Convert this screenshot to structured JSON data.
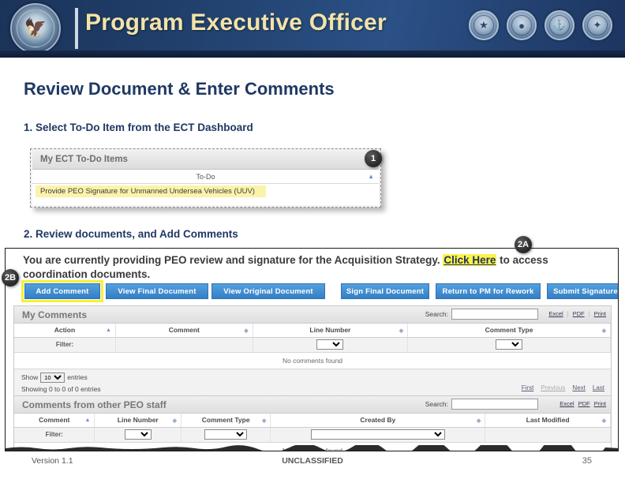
{
  "banner": {
    "title": "Program Executive Officer",
    "dod_seal_icon": "dod-seal-icon",
    "service_seals": [
      "army-seal-icon",
      "marine-corps-seal-icon",
      "navy-seal-icon",
      "air-force-seal-icon"
    ],
    "colors": {
      "bg_dark": "#1b3359",
      "bg_light": "#2b5186",
      "title": "#f2e3a8"
    }
  },
  "slide": {
    "title": "Review Document & Enter Comments",
    "step1": "1.  Select To-Do Item from the ECT Dashboard",
    "step2": "2.  Review documents, and Add Comments"
  },
  "callouts": {
    "one": "1",
    "two_a": "2A",
    "two_b": "2B"
  },
  "todo_panel": {
    "title": "My ECT To-Do Items",
    "column_header": "To-Do",
    "sort_icon": "sort-ascending-icon",
    "items": [
      "Provide PEO Signature for Unmanned Undersea Vehicles (UUV)"
    ]
  },
  "app": {
    "notice_prefix": "You are currently providing PEO review and signature for the Acquisition Strategy. ",
    "notice_link": "Click Here",
    "notice_suffix": " to access coordination documents.",
    "buttons_left": [
      {
        "label": "Add Comment",
        "highlighted": true
      },
      {
        "label": "View Final Document",
        "highlighted": false
      },
      {
        "label": "View Original Document",
        "highlighted": false
      }
    ],
    "buttons_right": [
      {
        "label": "Sign Final Document"
      },
      {
        "label": "Return to PM for Rework"
      },
      {
        "label": "Submit Signature"
      }
    ],
    "button_color": "#3d87cd",
    "highlight_color": "#f7f035"
  },
  "my_comments": {
    "title": "My Comments",
    "search_label": "Search:",
    "search_value": "",
    "export_links": [
      "Excel",
      "PDF",
      "Print"
    ],
    "columns": [
      "Action",
      "Comment",
      "Line Number",
      "Comment Type"
    ],
    "filter_label": "Filter:",
    "empty_text": "No comments found",
    "show_label": "Show",
    "show_value": "10",
    "entries_label": "entries",
    "showing_info": "Showing 0 to 0 of 0 entries",
    "pager": [
      "First",
      "Previous",
      "Next",
      "Last"
    ]
  },
  "other_comments": {
    "title": "Comments from other PEO staff",
    "search_label": "Search:",
    "search_value": "",
    "export_links": [
      "Excel",
      "PDF",
      "Print"
    ],
    "columns": [
      "Comment",
      "Line Number",
      "Comment Type",
      "Created By",
      "Last Modified"
    ],
    "filter_label": "Filter:",
    "empty_text": "No comments found"
  },
  "footer": {
    "version": "Version 1.1",
    "classification": "UNCLASSIFIED",
    "page_number": "35"
  }
}
